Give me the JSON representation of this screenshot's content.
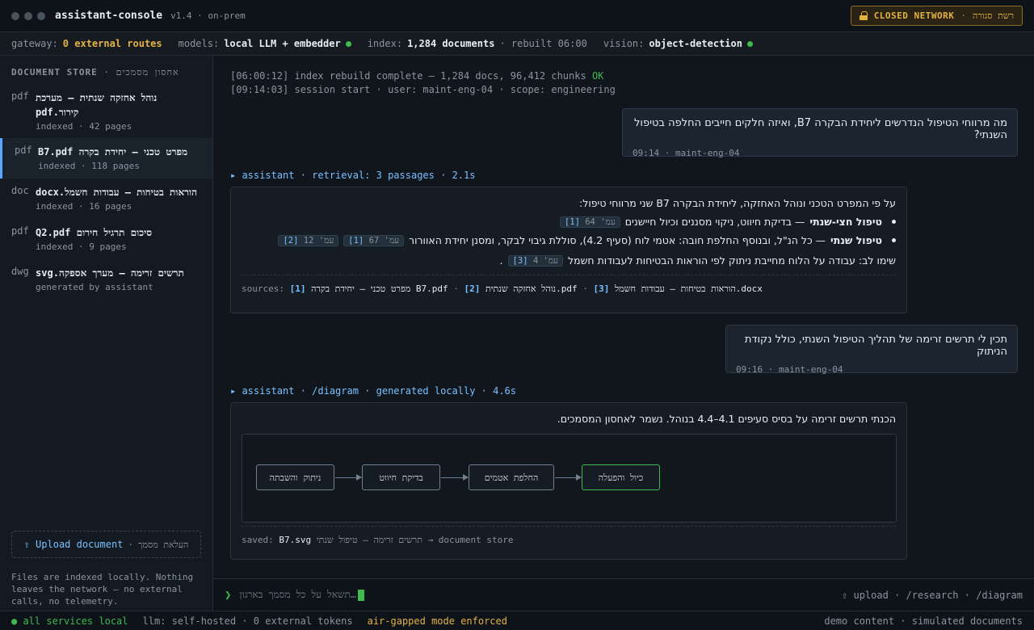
{
  "window": {
    "title": "assistant-console",
    "version": "v1.4 · on-prem",
    "network_badge": {
      "label": "CLOSED NETWORK",
      "separator": "·",
      "hebrew": "רשת סגורה"
    }
  },
  "status": {
    "gateway_key": "gateway:",
    "gateway_val": "0 external routes",
    "models_key": "models:",
    "models_val": "local LLM + embedder",
    "index_key": "index:",
    "index_val": "1,284 documents",
    "index_rebuilt": "· rebuilt 06:00",
    "vision_key": "vision:",
    "vision_val": "object-detection"
  },
  "sidebar": {
    "header_en": "DOCUMENT STORE",
    "header_sep": "·",
    "header_he": "אחסון מסמכים",
    "docs": [
      {
        "type": "pdf",
        "name": "נוהל אחזקה שנתית — מערכת קירור.pdf",
        "meta": "indexed · 42 pages"
      },
      {
        "type": "pdf",
        "name": "מפרט טכני — יחידת בקרה B7.pdf",
        "meta": "indexed · 118 pages"
      },
      {
        "type": "doc",
        "name": "הוראות בטיחות — עבודות חשמל.docx",
        "meta": "indexed · 16 pages"
      },
      {
        "type": "pdf",
        "name": "סיכום תרגיל חירום Q2.pdf",
        "meta": "indexed · 9 pages"
      },
      {
        "type": "dwg",
        "name": "תרשים זרימה — מערך אספקה.svg",
        "meta": "generated by assistant"
      }
    ],
    "upload_label": "⇪ Upload document",
    "upload_sep": "·",
    "upload_he": "העלאת מסמך",
    "note": "Files are indexed locally. Nothing leaves the network — no external calls, no telemetry."
  },
  "log": {
    "line1": "[06:00:12] index rebuild complete — 1,284 docs, 96,412 chunks",
    "line1_ok": "OK",
    "line2": "[09:14:03] session start · user: maint-eng-04 · scope: engineering"
  },
  "messages": {
    "user1": {
      "text": "מה מרווחי הטיפול הנדרשים ליחידת הבקרה B7, ואיזה חלקים חייבים החלפה בטיפול השנתי?",
      "meta": "09:14 · maint-eng-04"
    },
    "asst1": {
      "label": "▸ assistant · retrieval: 3 passages · 2.1s",
      "intro": "על פי המפרט הטכני ונוהל האחזקה, ליחידת הבקרה B7 שני מרווחי טיפול:",
      "bullet1_bold": "טיפול חצי-שנתי",
      "bullet1_text": "— בדיקת חיווט, ניקוי מסננים וכיול חיישנים",
      "bullet1_chip": "עמ' 64",
      "bullet1_ref": "[1]",
      "bullet2_bold": "טיפול שנתי",
      "bullet2_text": "— כל הנ\"ל, ובנוסף החלפת חובה: אטמי לוח (סעיף 4.2), סוללת גיבוי לבקר, ומסנן יחידת האוורור",
      "bullet2_chip1": "עמ' 67",
      "bullet2_ref1": "[1]",
      "bullet2_chip2": "עמ' 12",
      "bullet2_ref2": "[2]",
      "warning": "שימו לב: עבודה על הלוח מחייבת ניתוק לפי הוראות הבטיחות לעבודות חשמל",
      "warning_chip": "עמ' 4",
      "warning_ref": "[3]",
      "sources_label": "sources:",
      "s1_num": "[1]",
      "s1_name": "מפרט טכני — יחידת בקרה B7.pdf",
      "s2_num": "[2]",
      "s2_name": "נוהל אחזקה שנתית.pdf",
      "s3_num": "[3]",
      "s3_name": "הוראות בטיחות — עבודות חשמל.docx"
    },
    "user2": {
      "text": "תכין לי תרשים זרימה של תהליך הטיפול השנתי, כולל נקודת הניתוק",
      "meta": "09:16 · maint-eng-04"
    },
    "asst2": {
      "label": "▸ assistant · /diagram · generated locally · 4.6s",
      "intro": "הכנתי תרשים זרימה על בסיס סעיפים 4.1–4.4 בנוהל. נשמר לאחסון המסמכים.",
      "nodes": [
        "ניתוק והשבתה",
        "בדיקת חיווט",
        "החלפת אטמים",
        "כיול והפעלה"
      ],
      "saved_label": "saved:",
      "saved_file": "B7.svg",
      "saved_name": "תרשים זרימה — טיפול שנתי",
      "saved_dest": "→ document store"
    }
  },
  "input": {
    "placeholder": "תשאל על כל מסמך בארגון…",
    "commands": "⇪ upload · /research · /diagram"
  },
  "footer": {
    "services": "● all services local",
    "llm": "llm: self-hosted · 0 external tokens",
    "airgap": "air-gapped mode enforced",
    "right": "demo content · simulated documents"
  }
}
